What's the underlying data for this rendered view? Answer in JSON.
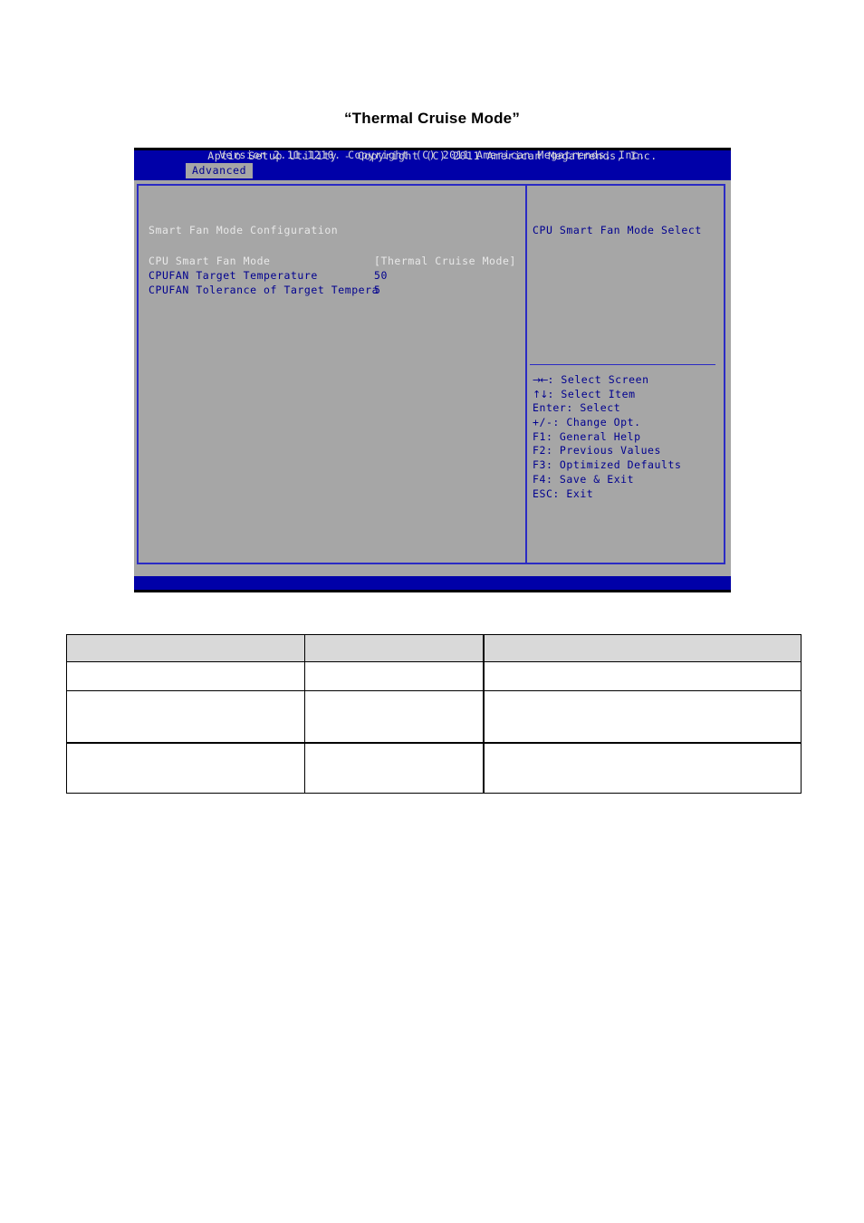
{
  "document": {
    "caption": "“Thermal Cruise Mode”"
  },
  "bios": {
    "header_title": "Aptio Setup Utility - Copyright (C) 2011 American Megatrends, Inc.",
    "active_tab": "Advanced",
    "footer": "Version 2.11.1210. Copyright (C) 2011 American Megatrends, Inc.",
    "colors": {
      "header_blue": "#0000a8",
      "panel_gray": "#a6a6a6",
      "border_blue": "#2b2bc4",
      "text_blue": "#00008f",
      "text_light": "#e8e8e8"
    },
    "settings_panel": {
      "section_title": "Smart Fan Mode Configuration",
      "options": [
        {
          "label": "CPU Smart Fan Mode",
          "value": "[Thermal Cruise Mode]",
          "selected": true
        },
        {
          "label": "CPUFAN Target Temperature",
          "value": "50",
          "selected": false
        },
        {
          "label": "CPUFAN Tolerance of Target Tempera",
          "value": "5",
          "selected": false
        }
      ]
    },
    "help_panel": {
      "title": "CPU Smart Fan Mode Select",
      "legend": [
        {
          "key": "→←",
          "text": ": Select Screen",
          "arrows": true
        },
        {
          "key": "↑↓",
          "text": ": Select Item",
          "arrows": true
        },
        {
          "key": "Enter",
          "text": ": Select",
          "arrows": false
        },
        {
          "key": "+/-",
          "text": ": Change Opt.",
          "arrows": false
        },
        {
          "key": "F1",
          "text": ": General Help",
          "arrows": false
        },
        {
          "key": "F2",
          "text": ": Previous Values",
          "arrows": false
        },
        {
          "key": "F3",
          "text": ": Optimized Defaults",
          "arrows": false
        },
        {
          "key": "F4",
          "text": ": Save & Exit",
          "arrows": false
        },
        {
          "key": "ESC",
          "text": ": Exit",
          "arrows": false
        }
      ]
    }
  },
  "description_table": {
    "headers": [
      "",
      "",
      ""
    ],
    "rows": [
      [
        "",
        "",
        ""
      ],
      [
        "",
        "",
        ""
      ],
      [
        "",
        "",
        ""
      ]
    ]
  }
}
